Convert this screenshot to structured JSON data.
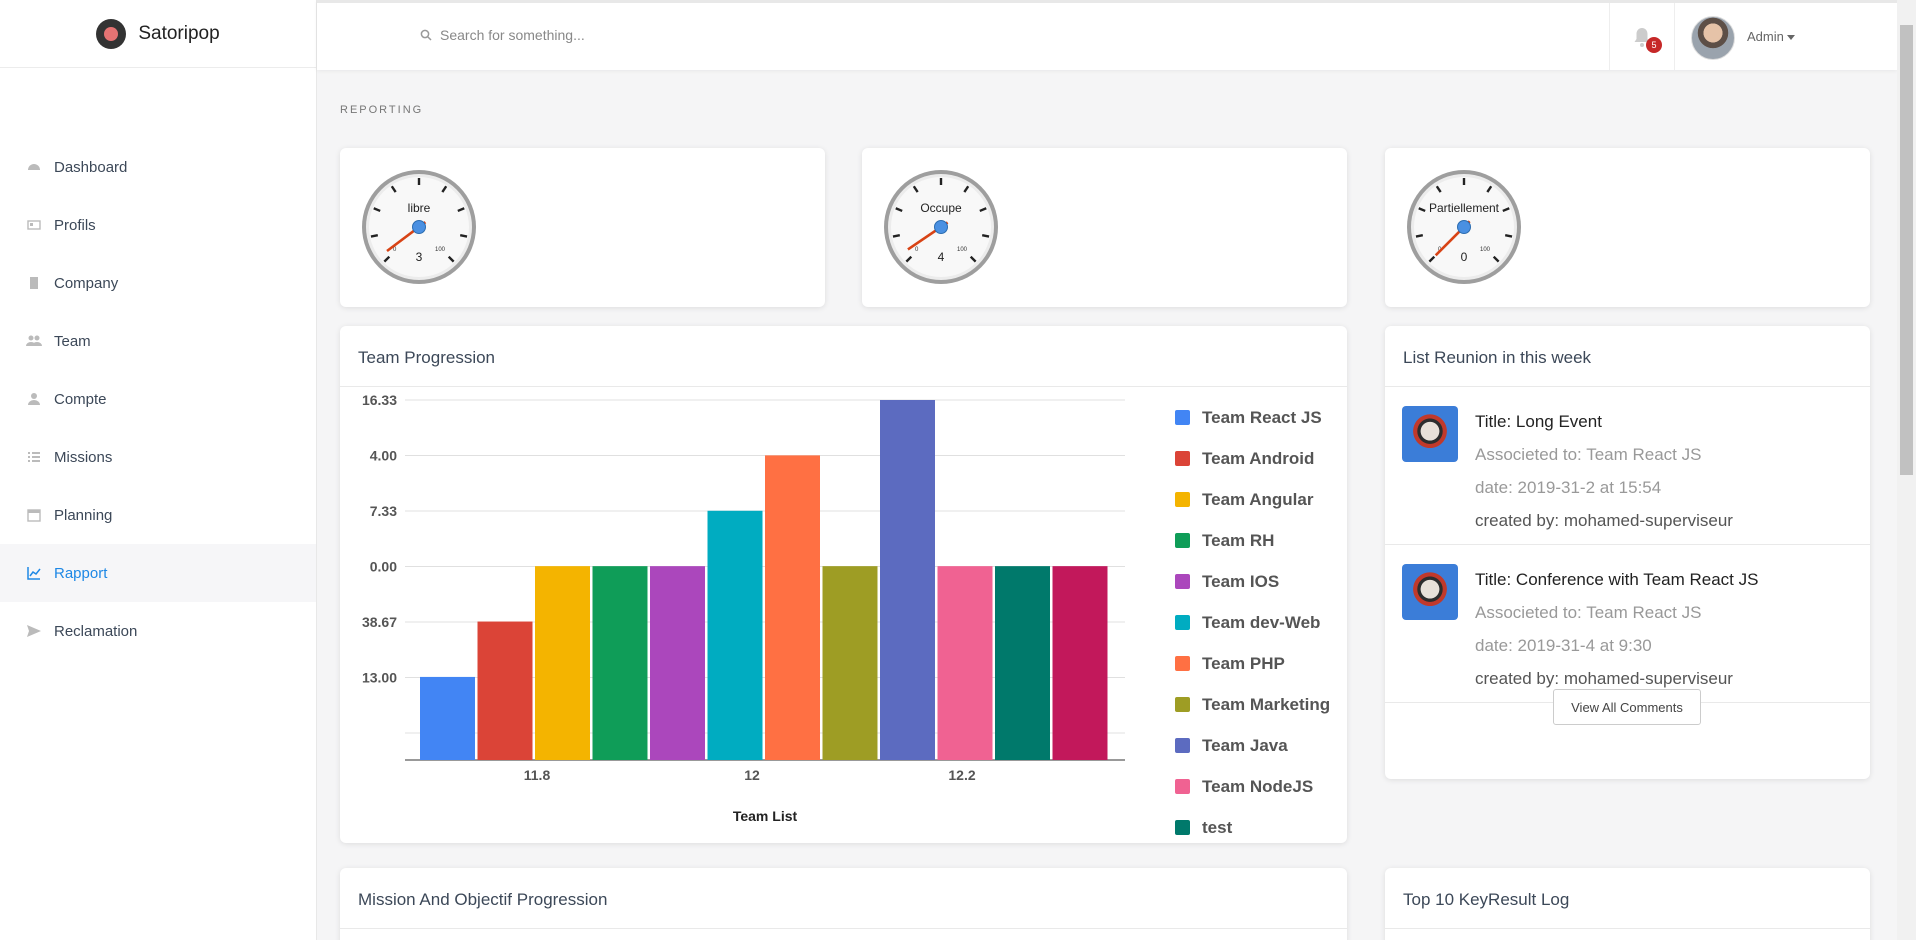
{
  "app": {
    "brand": "Satoripop"
  },
  "sidebar": {
    "items": [
      {
        "label": "Dashboard",
        "icon": "dashboard-icon"
      },
      {
        "label": "Profils",
        "icon": "id-card-icon"
      },
      {
        "label": "Company",
        "icon": "building-icon"
      },
      {
        "label": "Team",
        "icon": "users-icon"
      },
      {
        "label": "Compte",
        "icon": "user-icon"
      },
      {
        "label": "Missions",
        "icon": "list-icon"
      },
      {
        "label": "Planning",
        "icon": "calendar-icon"
      },
      {
        "label": "Rapport",
        "icon": "chart-line-icon",
        "active": true
      },
      {
        "label": "Reclamation",
        "icon": "send-icon"
      }
    ]
  },
  "topbar": {
    "search_placeholder": "Search for something...",
    "notification_count": "5",
    "user_label": "Admin"
  },
  "section_label": "REPORTING",
  "gauges": [
    {
      "label": "libre",
      "value": "3",
      "scale_min": "0",
      "scale_max": "100"
    },
    {
      "label": "Occupe",
      "value": "4",
      "scale_min": "0",
      "scale_max": "100"
    },
    {
      "label": "Partiellement",
      "value": "0",
      "scale_min": "0",
      "scale_max": "100"
    }
  ],
  "team_progression": {
    "title": "Team Progression"
  },
  "chart_data": {
    "type": "bar",
    "title": "Team Progression",
    "xlabel": "Team List",
    "ylabel": "",
    "x_ticks": [
      "11.8",
      "12",
      "12.2"
    ],
    "y_ticks": [
      "16.33",
      "4.00",
      "7.33",
      "0.00",
      "38.67",
      "13.00"
    ],
    "series": [
      {
        "name": "Team React JS",
        "value": 1.5,
        "color": "#4285f4"
      },
      {
        "name": "Team Android",
        "value": 2.5,
        "color": "#db4437"
      },
      {
        "name": "Team Angular",
        "value": 3.5,
        "color": "#f4b400"
      },
      {
        "name": "Team RH",
        "value": 3.5,
        "color": "#0f9d58"
      },
      {
        "name": "Team IOS",
        "value": 3.5,
        "color": "#ab47bc"
      },
      {
        "name": "Team dev-Web",
        "value": 4.5,
        "color": "#00acc1"
      },
      {
        "name": "Team PHP",
        "value": 5.5,
        "color": "#ff7043"
      },
      {
        "name": "Team Marketing",
        "value": 3.5,
        "color": "#9e9d24"
      },
      {
        "name": "Team Java",
        "value": 6.5,
        "color": "#5c6bc0"
      },
      {
        "name": "Team NodeJS",
        "value": 3.5,
        "color": "#f06292"
      },
      {
        "name": "test",
        "value": 3.5,
        "color": "#00796b"
      },
      {
        "name": "",
        "value": 3.5,
        "color": "#c2185b"
      }
    ],
    "y_range": [
      0,
      6.5
    ],
    "grid": true,
    "legend": "right"
  },
  "reunions": {
    "title": "List Reunion in this week",
    "items": [
      {
        "title": "Title: Long Event",
        "associated": "Associeted to: Team React JS",
        "date": "date: 2019-31-2 at 15:54",
        "created_by": "created by: mohamed-superviseur"
      },
      {
        "title": "Title: Conference with Team React JS",
        "associated": "Associeted to: Team React JS",
        "date": "date: 2019-31-4 at 9:30",
        "created_by": "created by: mohamed-superviseur"
      }
    ],
    "view_all_label": "View All Comments"
  },
  "bottom_cards": {
    "mission_title": "Mission And Objectif Progression",
    "keyresult_title": "Top 10 KeyResult Log"
  }
}
